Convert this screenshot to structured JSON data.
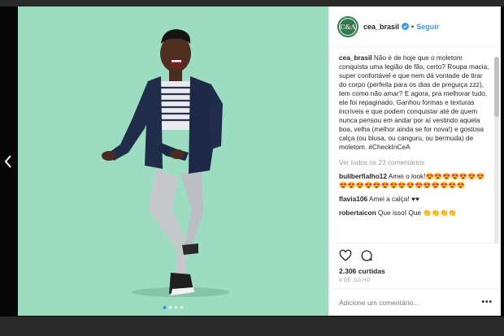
{
  "nav": {
    "prev_icon": "chevron-left-icon"
  },
  "post": {
    "username": "cea_brasil",
    "avatar_text": "C&A",
    "separator": "•",
    "follow_label": "Seguir",
    "caption_user": "cea_brasil",
    "caption_text": " Não é de hoje que o moletom conquista uma legião de fãs, certo? Roupa macia, super confortável e que nem dá vontade de tirar do corpo (perfeita para os dias de preguiça zzz), tem como não amar? E agora, pra melhorar tudo, ele foi repaginado. Ganhou formas e texturas incríveis e que podem conquistar até de quem nunca pensou em andar por aí vestindo aquela boa, velha (melhor ainda se for nova!) e gostosa calça (ou blusa, ou canguru, ou bermuda) de moletom. #CheckInCeA",
    "view_all": "Ver todos os 23 comentários",
    "comments": [
      {
        "user": "buliberfialho12",
        "text": " Amei o look!😍😍😍😍😍😍😍😍😍😍😍😍😍😍😍😍😍😍😍😍😍😍"
      },
      {
        "user": "flavia106",
        "text": " Amei a calça! ♥♥"
      },
      {
        "user": "robertaicon",
        "text": " Que issoI Que 👏👏👏👏"
      }
    ],
    "likes": "2.306 curtidas",
    "date": "8 DE JULHO",
    "comment_placeholder": "Adicione um comentário...",
    "more_label": "•••"
  },
  "carousel": {
    "count": 4,
    "active": 1
  },
  "colors": {
    "accent": "#3897f0",
    "photo_bg": "#9cdcc0",
    "brand": "#2f7d4c"
  }
}
